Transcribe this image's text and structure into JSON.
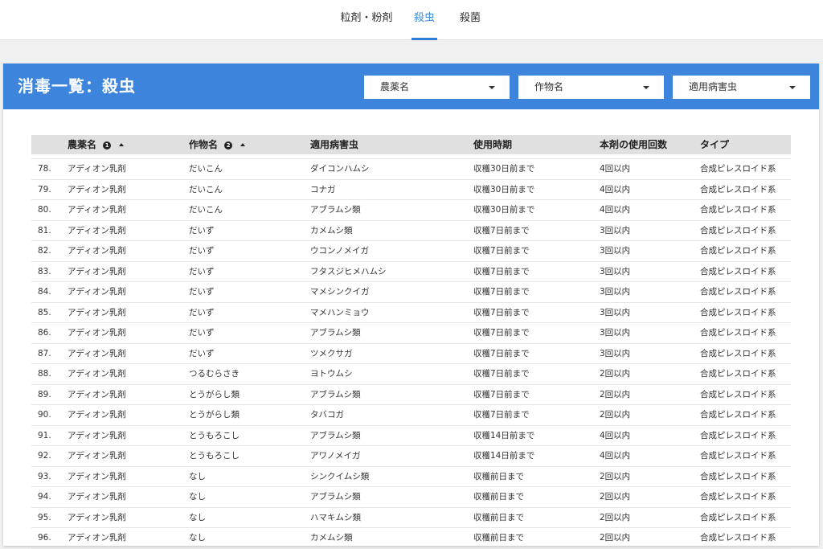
{
  "tabs": [
    {
      "label": "粒剤・粉剤",
      "active": false
    },
    {
      "label": "殺虫",
      "active": true
    },
    {
      "label": "殺菌",
      "active": false
    }
  ],
  "panel": {
    "title": "消毒一覧：殺虫",
    "filters": [
      {
        "label": "農薬名"
      },
      {
        "label": "作物名"
      },
      {
        "label": "適用病害虫"
      }
    ]
  },
  "table": {
    "headers": [
      {
        "label": "",
        "sort_index": null
      },
      {
        "label": "農薬名",
        "sort_index": "1"
      },
      {
        "label": "作物名",
        "sort_index": "2"
      },
      {
        "label": "適用病害虫",
        "sort_index": null
      },
      {
        "label": "使用時期",
        "sort_index": null
      },
      {
        "label": "本剤の使用回数",
        "sort_index": null
      },
      {
        "label": "タイプ",
        "sort_index": null
      }
    ],
    "rows": [
      [
        "78.",
        "アディオン乳剤",
        "だいこん",
        "ダイコンハムシ",
        "収穫30日前まで",
        "4回以内",
        "合成ピレスロイド系"
      ],
      [
        "79.",
        "アディオン乳剤",
        "だいこん",
        "コナガ",
        "収穫30日前まで",
        "4回以内",
        "合成ピレスロイド系"
      ],
      [
        "80.",
        "アディオン乳剤",
        "だいこん",
        "アブラムシ類",
        "収穫30日前まで",
        "4回以内",
        "合成ピレスロイド系"
      ],
      [
        "81.",
        "アディオン乳剤",
        "だいず",
        "カメムシ類",
        "収穫7日前まで",
        "3回以内",
        "合成ピレスロイド系"
      ],
      [
        "82.",
        "アディオン乳剤",
        "だいず",
        "ウコンノメイガ",
        "収穫7日前まで",
        "3回以内",
        "合成ピレスロイド系"
      ],
      [
        "83.",
        "アディオン乳剤",
        "だいず",
        "フタスジヒメハムシ",
        "収穫7日前まで",
        "3回以内",
        "合成ピレスロイド系"
      ],
      [
        "84.",
        "アディオン乳剤",
        "だいず",
        "マメシンクイガ",
        "収穫7日前まで",
        "3回以内",
        "合成ピレスロイド系"
      ],
      [
        "85.",
        "アディオン乳剤",
        "だいず",
        "マメハンミョウ",
        "収穫7日前まで",
        "3回以内",
        "合成ピレスロイド系"
      ],
      [
        "86.",
        "アディオン乳剤",
        "だいず",
        "アブラムシ類",
        "収穫7日前まで",
        "3回以内",
        "合成ピレスロイド系"
      ],
      [
        "87.",
        "アディオン乳剤",
        "だいず",
        "ツメクサガ",
        "収穫7日前まで",
        "3回以内",
        "合成ピレスロイド系"
      ],
      [
        "88.",
        "アディオン乳剤",
        "つるむらさき",
        "ヨトウムシ",
        "収穫7日前まで",
        "2回以内",
        "合成ピレスロイド系"
      ],
      [
        "89.",
        "アディオン乳剤",
        "とうがらし類",
        "アブラムシ類",
        "収穫7日前まで",
        "2回以内",
        "合成ピレスロイド系"
      ],
      [
        "90.",
        "アディオン乳剤",
        "とうがらし類",
        "タバコガ",
        "収穫7日前まで",
        "2回以内",
        "合成ピレスロイド系"
      ],
      [
        "91.",
        "アディオン乳剤",
        "とうもろこし",
        "アブラムシ類",
        "収穫14日前まで",
        "4回以内",
        "合成ピレスロイド系"
      ],
      [
        "92.",
        "アディオン乳剤",
        "とうもろこし",
        "アワノメイガ",
        "収穫14日前まで",
        "4回以内",
        "合成ピレスロイド系"
      ],
      [
        "93.",
        "アディオン乳剤",
        "なし",
        "シンクイムシ類",
        "収穫前日まで",
        "2回以内",
        "合成ピレスロイド系"
      ],
      [
        "94.",
        "アディオン乳剤",
        "なし",
        "アブラムシ類",
        "収穫前日まで",
        "2回以内",
        "合成ピレスロイド系"
      ],
      [
        "95.",
        "アディオン乳剤",
        "なし",
        "ハマキムシ類",
        "収穫前日まで",
        "2回以内",
        "合成ピレスロイド系"
      ],
      [
        "96.",
        "アディオン乳剤",
        "なし",
        "カメムシ類",
        "収穫前日まで",
        "2回以内",
        "合成ピレスロイド系"
      ]
    ]
  }
}
